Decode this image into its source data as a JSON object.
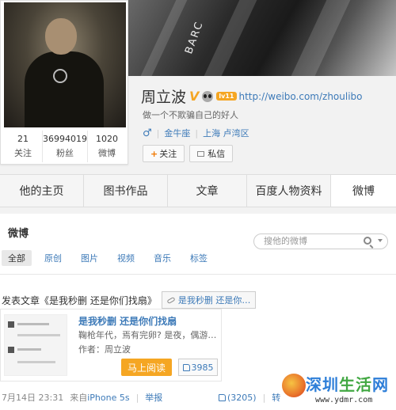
{
  "cover": {
    "plate_text": "BARC"
  },
  "profile": {
    "stats": [
      {
        "value": "21",
        "label": "关注"
      },
      {
        "value": "36994019",
        "label": "粉丝"
      },
      {
        "value": "1020",
        "label": "微博"
      }
    ],
    "name": "周立波",
    "verified_badge": "V",
    "level_badge": "lv11",
    "url": "http://weibo.com/zhoulibo",
    "motto": "做一个不欺骗自己的好人",
    "gender_symbol": "♂",
    "zodiac": "金牛座",
    "location": "上海 卢湾区",
    "follow_label": "关注",
    "follow_plus": "+",
    "message_label": "私信"
  },
  "tabs": [
    "他的主页",
    "图书作品",
    "文章",
    "百度人物资料",
    "微博"
  ],
  "weibo": {
    "title": "微博",
    "search_placeholder": "搜他的微博",
    "filters": [
      "全部",
      "原创",
      "图片",
      "视频",
      "音乐",
      "标签"
    ],
    "post_text": "发表文章《是我秒删 还是你们找扇》",
    "link_chip": "是我秒删 还是你…",
    "article": {
      "title": "是我秒删 还是你们找扇",
      "desc": "鞠枪年代，焉有完卵? 是夜，偶游…",
      "author": "作者：周立波",
      "read_label": "马上阅读",
      "like_count": "3985"
    },
    "footer": {
      "time": "7月14日 23:31",
      "source_prefix": "来自",
      "device": "iPhone 5s",
      "report": "举报",
      "likes": "(3205)",
      "forward": "转"
    }
  },
  "watermark": {
    "title_a": "深圳",
    "title_b": "生活",
    "title_c": "网",
    "url": "www.ydmr.com"
  }
}
